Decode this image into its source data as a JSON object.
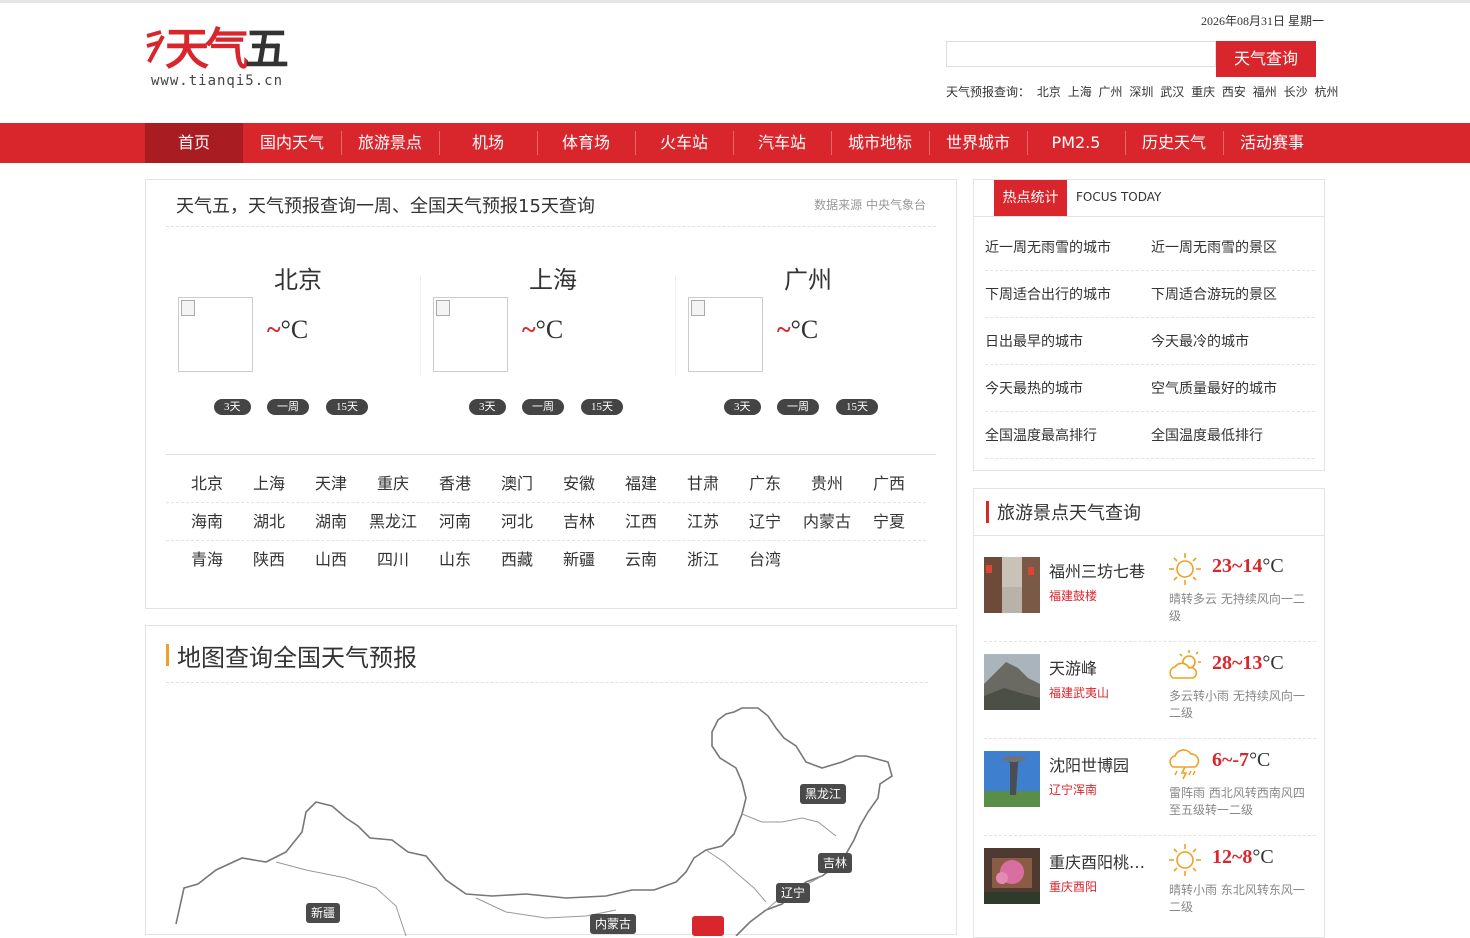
{
  "header": {
    "logo_text_red": "天气",
    "logo_text_dark": "五",
    "logo_url": "www.tianqi5.cn",
    "date": "2026年08月31日 星期一",
    "search_placeholder": "",
    "search_button": "天气查询",
    "hot_cities_label": "天气预报查询：",
    "hot_cities": [
      "北京",
      "上海",
      "广州",
      "深圳",
      "武汉",
      "重庆",
      "西安",
      "福州",
      "长沙",
      "杭州"
    ]
  },
  "nav": {
    "items": [
      "首页",
      "国内天气",
      "旅游景点",
      "机场",
      "体育场",
      "火车站",
      "汽车站",
      "城市地标",
      "世界城市",
      "PM2.5",
      "历史天气",
      "活动赛事"
    ],
    "active_index": 0
  },
  "forecast_panel": {
    "title": "天气五，天气预报查询一周、全国天气预报15天查询",
    "source": "数据来源 中央气象台",
    "cities": [
      {
        "name": "北京",
        "temp_tilde": "~",
        "temp_unit": "°C"
      },
      {
        "name": "上海",
        "temp_tilde": "~",
        "temp_unit": "°C"
      },
      {
        "name": "广州",
        "temp_tilde": "~",
        "temp_unit": "°C"
      }
    ],
    "range_buttons": [
      "3天",
      "一周",
      "15天"
    ],
    "provinces": [
      [
        "北京",
        "上海",
        "天津",
        "重庆",
        "香港",
        "澳门",
        "安徽",
        "福建",
        "甘肃",
        "广东",
        "贵州",
        "广西"
      ],
      [
        "海南",
        "湖北",
        "湖南",
        "黑龙江",
        "河南",
        "河北",
        "吉林",
        "江西",
        "江苏",
        "辽宁",
        "内蒙古",
        "宁夏"
      ],
      [
        "青海",
        "陕西",
        "山西",
        "四川",
        "山东",
        "西藏",
        "新疆",
        "云南",
        "浙江",
        "台湾"
      ]
    ]
  },
  "map_panel": {
    "title": "地图查询全国天气预报",
    "labels": [
      "黑龙江",
      "吉林",
      "辽宁",
      "新疆",
      "内蒙古"
    ]
  },
  "hot_stats": {
    "tab_active": "热点统计",
    "tab_other": "FOCUS TODAY",
    "rows": [
      [
        "近一周无雨雪的城市",
        "近一周无雨雪的景区"
      ],
      [
        "下周适合出行的城市",
        "下周适合游玩的景区"
      ],
      [
        "日出最早的城市",
        "今天最冷的城市"
      ],
      [
        "今天最热的城市",
        "空气质量最好的城市"
      ],
      [
        "全国温度最高排行",
        "全国温度最低排行"
      ]
    ]
  },
  "scenic_panel": {
    "title": "旅游景点天气查询",
    "spots": [
      {
        "name": "福州三坊七巷",
        "location": "福建鼓楼",
        "temp": "23~14",
        "unit": "°C",
        "desc": "晴转多云 无持续风向一二级",
        "icon": "sunny-icon"
      },
      {
        "name": "天游峰",
        "location": "福建武夷山",
        "temp": "28~13",
        "unit": "°C",
        "desc": "多云转小雨 无持续风向一二级",
        "icon": "partly-cloudy-icon"
      },
      {
        "name": "沈阳世博园",
        "location": "辽宁浑南",
        "temp": "6~-7",
        "unit": "°C",
        "desc": "雷阵雨 西北风转西南风四至五级转一二级",
        "icon": "thunder-rain-icon"
      },
      {
        "name": "重庆酉阳桃花源",
        "location": "重庆酉阳",
        "temp": "12~8",
        "unit": "°C",
        "desc": "晴转小雨 东北风转东风一二级",
        "icon": "sunny-icon"
      }
    ]
  },
  "colors": {
    "brand_red": "#d9262c",
    "nav_active": "#a81c22",
    "accent_orange": "#f0a023"
  }
}
